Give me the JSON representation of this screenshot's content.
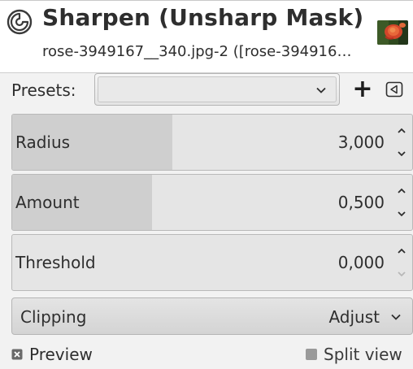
{
  "header": {
    "title": "Sharpen (Unsharp Mask)",
    "subtitle": "rose-3949167__340.jpg-2 ([rose-394916…",
    "icon": "gimp-wilber-swirl-icon",
    "thumbnail": "rose-image-thumbnail"
  },
  "presets": {
    "label": "Presets:",
    "selected": "",
    "add_label": "+",
    "menu_icon": "triangle-left-menu-icon"
  },
  "params": [
    {
      "label": "Radius",
      "value": "3,000",
      "fill_fraction": 0.4
    },
    {
      "label": "Amount",
      "value": "0,500",
      "fill_fraction": 0.35
    },
    {
      "label": "Threshold",
      "value": "0,000",
      "fill_fraction": 0.0
    }
  ],
  "clipping": {
    "label": "Clipping",
    "value": "Adjust"
  },
  "options": {
    "preview_label": "Preview",
    "preview_checked": true,
    "split_view_label": "Split view",
    "split_view_checked": false
  },
  "colors": {
    "background": "#f2f2f2",
    "scale_fill": "#cfcfcf",
    "scale_track": "#e5e5e5",
    "text": "#2e2e2e"
  }
}
